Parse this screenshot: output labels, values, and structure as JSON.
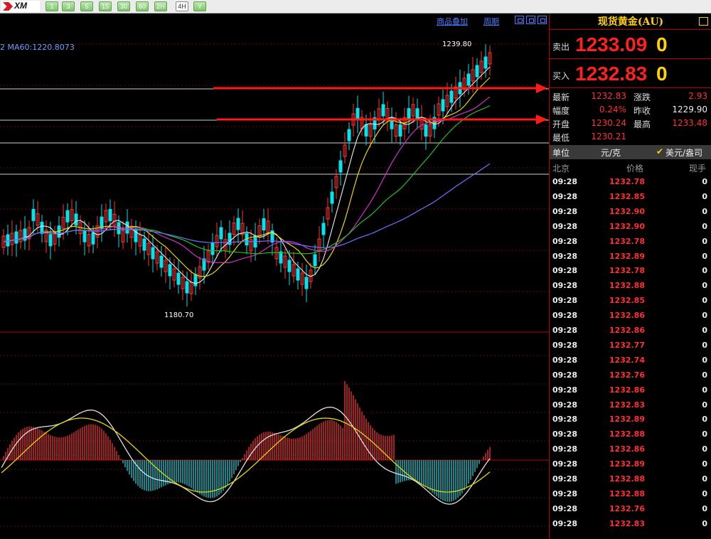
{
  "toolbar": {
    "logo_text": "XM",
    "periods": [
      "1",
      "3",
      "5",
      "15",
      "30",
      "60",
      "2H",
      "4H",
      "Y"
    ],
    "selected_period": "4H"
  },
  "chart": {
    "ma_label": "2 MA60:1220.8073",
    "overlay_link": "商品叠加",
    "period_link": "周期",
    "high_label": "1239.80",
    "low_label": "1180.70",
    "colors": {
      "bull": "#00e5ee",
      "bear": "#ff3232",
      "ma5": "#e0e0e0",
      "ma10": "#e8d800",
      "ma20": "#cc33cc",
      "ma30": "#20c020",
      "ma60": "#7070ff",
      "arrow": "#ff1a1a"
    }
  },
  "panel": {
    "title": "现货黄金(AU)",
    "sell_label": "卖出",
    "sell_price": "1233.09",
    "sell_qty": "0",
    "buy_label": "买入",
    "buy_price": "1232.83",
    "buy_qty": "0",
    "stats": [
      {
        "label": "最新",
        "value": "1232.83",
        "label2": "涨跌",
        "value2": "2.93"
      },
      {
        "label": "幅度",
        "value": "0.24%",
        "label2": "昨收",
        "value2": "1229.90"
      },
      {
        "label": "开盘",
        "value": "1230.24",
        "label2": "最高",
        "value2": "1233.48"
      },
      {
        "label": "最低",
        "value": "1230.21",
        "label2": "",
        "value2": ""
      }
    ],
    "unit_label": "单位",
    "unit_value": "元/克",
    "unit_alt": "美元/盎司",
    "col_time": "北京",
    "col_price": "价格",
    "col_qty": "现手",
    "ticks": [
      {
        "t": "09:28",
        "p": "1232.78",
        "q": "0"
      },
      {
        "t": "09:28",
        "p": "1232.85",
        "q": "0"
      },
      {
        "t": "09:28",
        "p": "1232.90",
        "q": "0"
      },
      {
        "t": "09:28",
        "p": "1232.90",
        "q": "0"
      },
      {
        "t": "09:28",
        "p": "1232.78",
        "q": "0"
      },
      {
        "t": "09:28",
        "p": "1232.89",
        "q": "0"
      },
      {
        "t": "09:28",
        "p": "1232.78",
        "q": "0"
      },
      {
        "t": "09:28",
        "p": "1232.88",
        "q": "0"
      },
      {
        "t": "09:28",
        "p": "1232.85",
        "q": "0"
      },
      {
        "t": "09:28",
        "p": "1232.86",
        "q": "0"
      },
      {
        "t": "09:28",
        "p": "1232.86",
        "q": "0"
      },
      {
        "t": "09:28",
        "p": "1232.77",
        "q": "0"
      },
      {
        "t": "09:28",
        "p": "1232.74",
        "q": "0"
      },
      {
        "t": "09:28",
        "p": "1232.76",
        "q": "0"
      },
      {
        "t": "09:28",
        "p": "1232.86",
        "q": "0"
      },
      {
        "t": "09:28",
        "p": "1232.83",
        "q": "0"
      },
      {
        "t": "09:28",
        "p": "1232.89",
        "q": "0"
      },
      {
        "t": "09:28",
        "p": "1232.88",
        "q": "0"
      },
      {
        "t": "09:28",
        "p": "1232.86",
        "q": "0"
      },
      {
        "t": "09:28",
        "p": "1232.89",
        "q": "0"
      },
      {
        "t": "09:28",
        "p": "1232.88",
        "q": "0"
      },
      {
        "t": "09:28",
        "p": "1232.88",
        "q": "0"
      },
      {
        "t": "09:28",
        "p": "1232.76",
        "q": "0"
      },
      {
        "t": "09:28",
        "p": "1232.83",
        "q": "0"
      }
    ]
  }
}
